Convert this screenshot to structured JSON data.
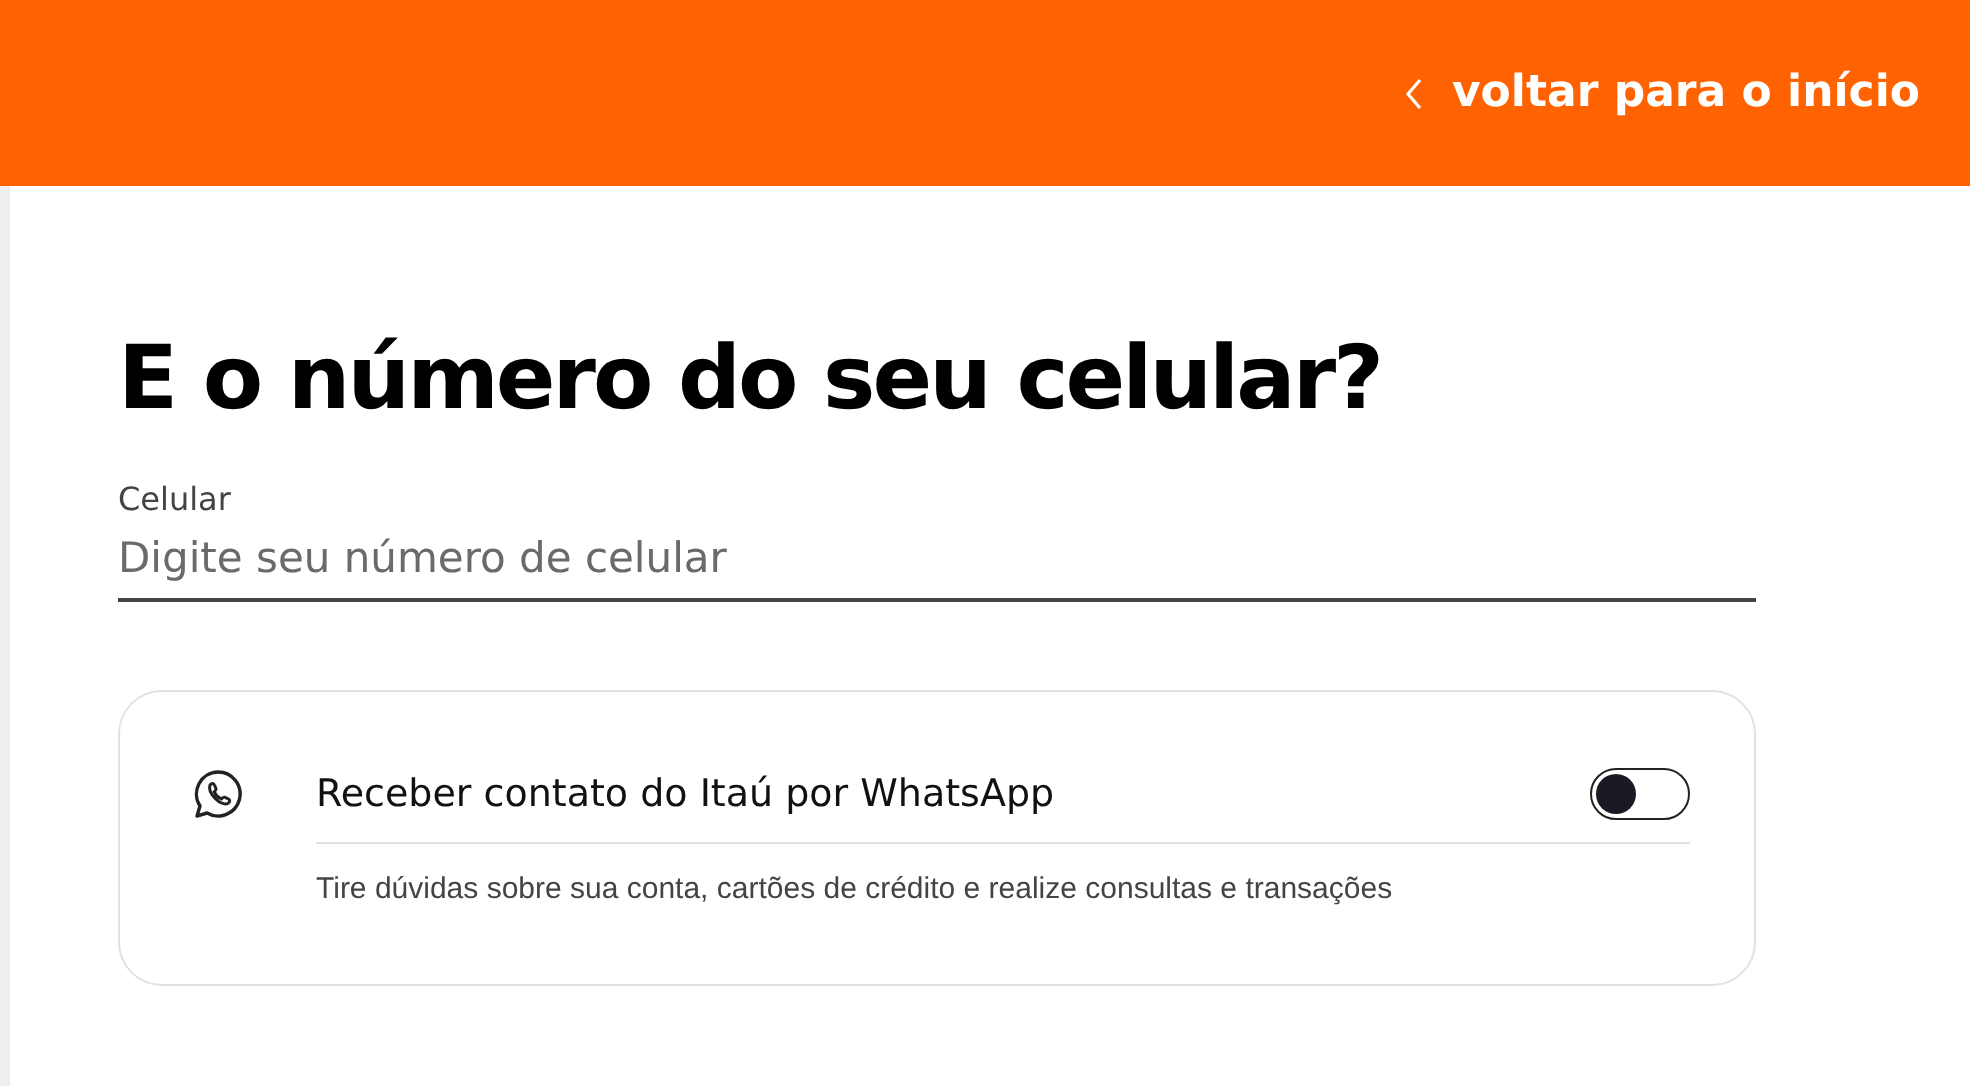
{
  "header": {
    "back_link": "voltar para o início"
  },
  "title": "E o número do seu celular?",
  "phone_field": {
    "label": "Celular",
    "placeholder": "Digite seu número de celular"
  },
  "whatsapp_card": {
    "label": "Receber contato do Itaú por WhatsApp",
    "on": false,
    "description": "Tire dúvidas sobre sua conta, cartões de crédito e realize consultas e transações"
  }
}
